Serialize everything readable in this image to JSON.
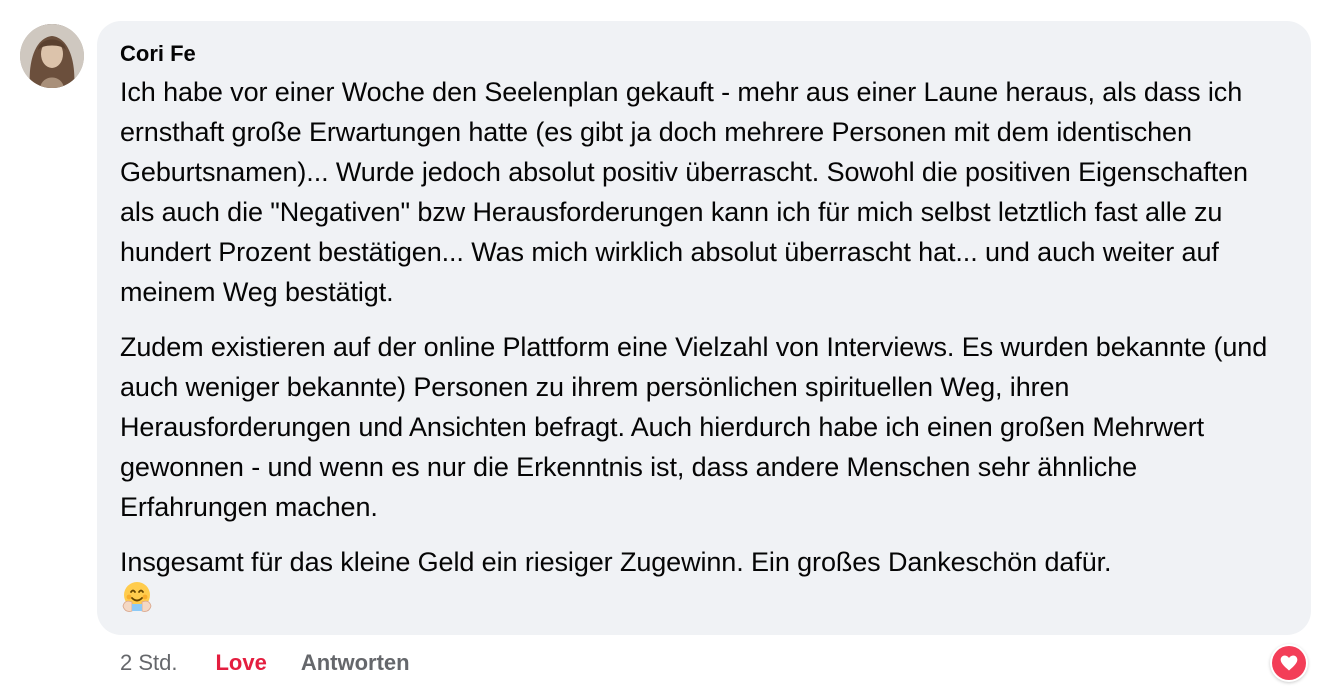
{
  "comment": {
    "author": "Cori Fe",
    "paragraphs": [
      "Ich habe vor einer Woche den Seelenplan gekauft - mehr aus einer Laune heraus, als dass ich ernsthaft große Erwartungen hatte (es gibt ja doch mehrere Personen mit dem identischen Geburtsnamen)... Wurde jedoch absolut positiv überrascht. Sowohl die positiven Eigenschaften als auch die \"Negativen\" bzw Herausforderungen kann ich für mich selbst letztlich fast alle zu hundert Prozent bestätigen... Was mich wirklich absolut überrascht hat... und auch weiter auf meinem Weg bestätigt.",
      "Zudem existieren auf der online Plattform eine Vielzahl von Interviews. Es wurden bekannte (und auch weniger bekannte) Personen zu ihrem persönlichen spirituellen Weg, ihren Herausforderungen und Ansichten befragt. Auch hierdurch habe ich einen großen Mehrwert gewonnen - und wenn es nur die Erkenntnis ist, dass andere Menschen sehr ähnliche Erfahrungen machen.",
      "Insgesamt für das kleine Geld ein riesiger Zugewinn. Ein großes Dankeschön dafür."
    ],
    "emoji_icon": "hugging-face-icon"
  },
  "actions": {
    "time": "2 Std.",
    "love_label": "Love",
    "reply_label": "Antworten"
  },
  "reaction": {
    "icon": "heart-icon",
    "color": "#f33e58"
  },
  "colors": {
    "bubble": "#f0f2f5",
    "love": "#e41e3f",
    "muted": "#65676b"
  }
}
